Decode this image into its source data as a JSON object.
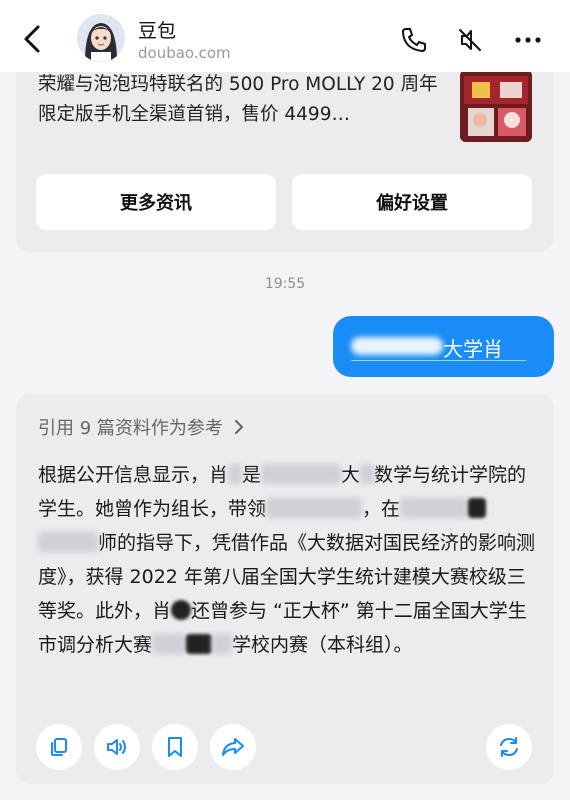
{
  "header": {
    "title": "豆包",
    "subtitle": "doubao.com"
  },
  "news": {
    "text": "荣耀与泡泡玛特联名的 500 Pro MOLLY 20 周年限定版手机全渠道首销，售价 4499…",
    "more_button": "更多资讯",
    "prefs_button": "偏好设置"
  },
  "timestamp": "19:55",
  "user_message": {
    "visible_text": "大学肖"
  },
  "answer": {
    "refs_label": "引用 9 篇资料作为参考",
    "p1": "根据公开信息显示，肖",
    "p2": "是",
    "p3": "大",
    "p4": "数学与统计学院的学生。她曾作为组长，带领",
    "p5": "，在",
    "p6": "师的指导下，凭借作品《大数据对国民经济的影响测度》，获得 2022 年第八届全国大学生统计建模大赛校级三等奖。此外，肖",
    "p7": "还曾参与 “正大杯” 第十二届全国大学生市调分析大赛",
    "p8": "学校内赛（本科组）。"
  },
  "actions": [
    "copy-icon",
    "speaker-icon",
    "bookmark-icon",
    "share-icon",
    "regenerate-icon"
  ],
  "colors": {
    "accent": "#1a8cf5",
    "card_bg": "#ececef",
    "page_bg": "#f4f4f6"
  }
}
